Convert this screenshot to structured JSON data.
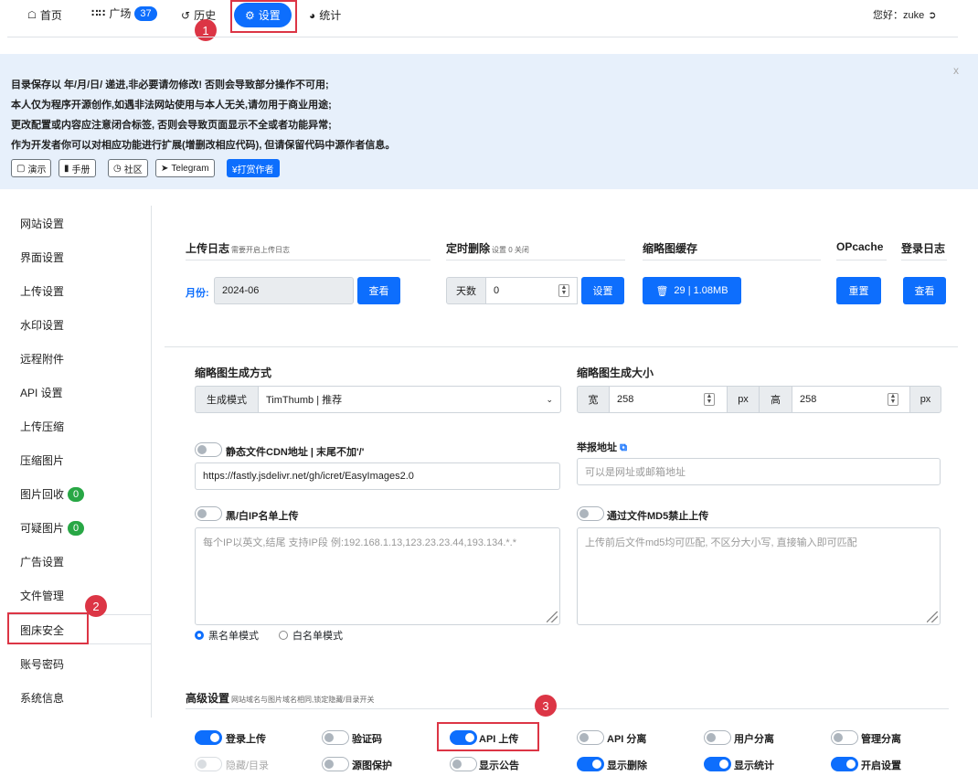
{
  "nav": {
    "home": "首页",
    "square": "广场",
    "square_count": "37",
    "history": "历史",
    "settings": "设置",
    "stats": "统计",
    "greeting": "您好：zuke"
  },
  "notice": {
    "close": "x",
    "lines": [
      "目录保存以 年/月/日/ 递进,非必要请勿修改! 否则会导致部分操作不可用;",
      "本人仅为程序开源创作,如遇非法网站使用与本人无关,请勿用于商业用途;",
      "更改配置或内容应注意闭合标签, 否则会导致页面显示不全或者功能异常;",
      "作为开发者你可以对相应功能进行扩展(增删改相应代码), 但请保留代码中源作者信息。"
    ],
    "buttons": [
      "演示",
      "手册",
      "社区",
      "Telegram",
      "¥打赏作者"
    ]
  },
  "sidebar": {
    "items": [
      "网站设置",
      "界面设置",
      "上传设置",
      "水印设置",
      "远程附件",
      "API 设置",
      "上传压缩",
      "压缩图片",
      "图片回收",
      "可疑图片",
      "广告设置",
      "文件管理",
      "图床安全",
      "账号密码",
      "系统信息"
    ],
    "recycle_count": "0",
    "suspicious_count": "0"
  },
  "annotations": [
    "1",
    "2",
    "3"
  ],
  "upload_log": {
    "title": "上传日志",
    "hint": "需要开启上传日志",
    "month_label": "月份:",
    "month_value": "2024-06",
    "view": "查看"
  },
  "scheduled_delete": {
    "title": "定时删除",
    "hint": "设置 0 关闭",
    "days_label": "天数",
    "days_value": "0",
    "set": "设置"
  },
  "thumb_cache": {
    "title": "缩略图缓存",
    "value": "29 | 1.08MB"
  },
  "opcache": {
    "title": "OPcache",
    "reset": "重置"
  },
  "login_log": {
    "title": "登录日志",
    "view": "查看"
  },
  "thumb_mode": {
    "title": "缩略图生成方式",
    "label": "生成模式",
    "value": "TimThumb | 推荐"
  },
  "thumb_size": {
    "title": "缩略图生成大小",
    "width_label": "宽",
    "width": "258",
    "height_label": "高",
    "height": "258",
    "unit": "px"
  },
  "cdn": {
    "title": "静态文件CDN地址 | 末尾不加'/'",
    "value": "https://fastly.jsdelivr.net/gh/icret/EasyImages2.0"
  },
  "report": {
    "title": "举报地址",
    "placeholder": "可以是网址或邮箱地址"
  },
  "ip_list": {
    "title": "黑/白IP名单上传",
    "placeholder": "每个IP以英文,结尾 支持IP段 例:192.168.1.13,123.23.23.44,193.134.*.*",
    "black": "黑名单模式",
    "white": "白名单模式"
  },
  "md5": {
    "title": "通过文件MD5禁止上传",
    "placeholder": "上传前后文件md5均可匹配, 不区分大小写, 直接输入即可匹配"
  },
  "advanced": {
    "title": "高级设置",
    "hint": "网站域名与图片域名相同,锁定隐藏/目录开关",
    "toggles": [
      {
        "label": "登录上传",
        "on": true
      },
      {
        "label": "验证码",
        "on": false
      },
      {
        "label": "API 上传",
        "on": true
      },
      {
        "label": "API 分离",
        "on": false
      },
      {
        "label": "用户分离",
        "on": false
      },
      {
        "label": "管理分离",
        "on": false
      },
      {
        "label": "隐藏/目录",
        "on": false
      },
      {
        "label": "源图保护",
        "on": false
      },
      {
        "label": "显示公告",
        "on": false
      },
      {
        "label": "显示删除",
        "on": true
      },
      {
        "label": "显示统计",
        "on": true
      },
      {
        "label": "开启设置",
        "on": true
      }
    ]
  },
  "colors": {
    "primary": "#0d6efd",
    "annotation": "#dc3545",
    "badge_green": "#28a745",
    "notice_bg": "#e7f0fb"
  }
}
